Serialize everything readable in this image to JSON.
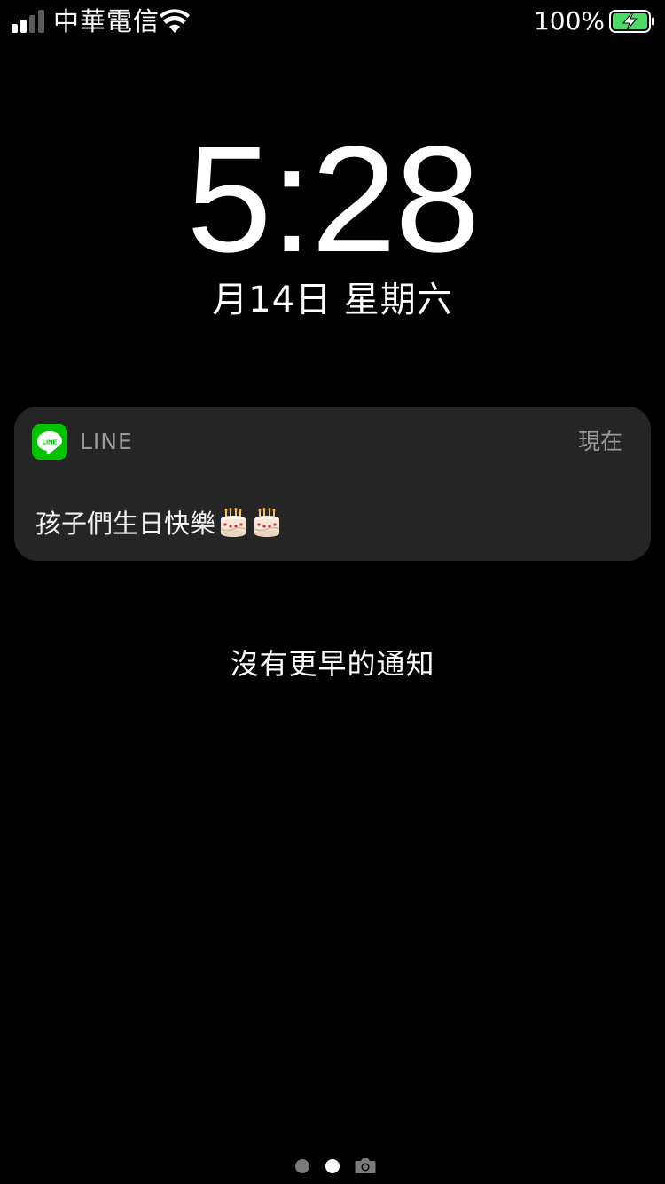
{
  "status_bar": {
    "carrier": "中華電信",
    "battery_percent": "100%",
    "signal_bars_filled": 2,
    "signal_bars_total": 4,
    "battery_level": 1.0,
    "charging": true,
    "battery_color": "#4cd964"
  },
  "lock_screen": {
    "time": "5:28",
    "date": "月14日 星期六"
  },
  "notification": {
    "app_icon": "line-app-icon",
    "app_icon_label": "LINE",
    "app_icon_color": "#00c300",
    "app_name": "LINE",
    "time": "現在",
    "message": "孩子們生日快樂",
    "emoji": [
      "birthday-cake-icon",
      "birthday-cake-icon"
    ]
  },
  "footer": {
    "no_older_text": "沒有更早的通知",
    "page_indicator": {
      "pages": 2,
      "current_page": 2,
      "trailing_icon": "camera-icon"
    }
  }
}
